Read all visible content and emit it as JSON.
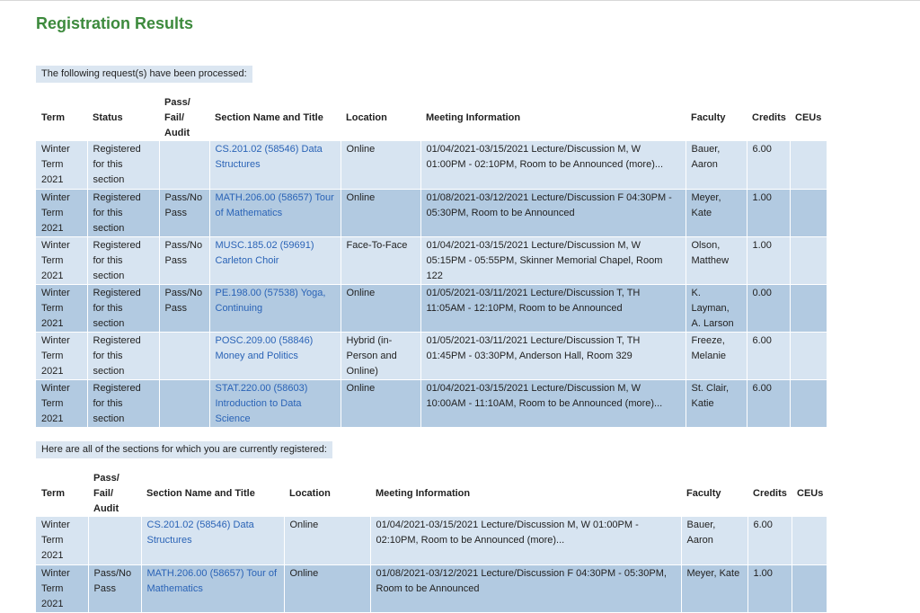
{
  "page_title": "Registration Results",
  "processed_banner": "The following request(s) have been processed:",
  "registered_banner": "Here are all of the sections for which you are currently registered:",
  "processed_headers": {
    "term": "Term",
    "status": "Status",
    "pass_fail": [
      "Pass/",
      "Fail/",
      "Audit"
    ],
    "section": "Section Name and Title",
    "location": "Location",
    "meeting": "Meeting Information",
    "faculty": "Faculty",
    "credits": "Credits",
    "ceus": "CEUs"
  },
  "processed_rows": [
    {
      "term": "Winter Term 2021",
      "status": "Registered for this section",
      "pass_fail": "",
      "section": "CS.201.02 (58546) Data Structures",
      "location": "Online",
      "meeting": "01/04/2021-03/15/2021 Lecture/Discussion M, W 01:00PM - 02:10PM, Room to be Announced (more)...",
      "faculty": "Bauer, Aaron",
      "credits": "6.00",
      "ceus": ""
    },
    {
      "term": "Winter Term 2021",
      "status": "Registered for this section",
      "pass_fail": "Pass/No Pass",
      "section": "MATH.206.00 (58657) Tour of Mathematics",
      "location": "Online",
      "meeting": "01/08/2021-03/12/2021 Lecture/Discussion F 04:30PM - 05:30PM, Room to be Announced",
      "faculty": "Meyer, Kate",
      "credits": "1.00",
      "ceus": ""
    },
    {
      "term": "Winter Term 2021",
      "status": "Registered for this section",
      "pass_fail": "Pass/No Pass",
      "section": "MUSC.185.02 (59691) Carleton Choir",
      "location": "Face-To-Face",
      "meeting": "01/04/2021-03/15/2021 Lecture/Discussion M, W 05:15PM - 05:55PM, Skinner Memorial Chapel, Room 122",
      "faculty": "Olson, Matthew",
      "credits": "1.00",
      "ceus": ""
    },
    {
      "term": "Winter Term 2021",
      "status": "Registered for this section",
      "pass_fail": "Pass/No Pass",
      "section": "PE.198.00 (57538) Yoga, Continuing",
      "location": "Online",
      "meeting": "01/05/2021-03/11/2021 Lecture/Discussion T, TH 11:05AM - 12:10PM, Room to be Announced",
      "faculty": "K. Layman, A. Larson",
      "credits": "0.00",
      "ceus": ""
    },
    {
      "term": "Winter Term 2021",
      "status": "Registered for this section",
      "pass_fail": "",
      "section": "POSC.209.00 (58846) Money and Politics",
      "location": "Hybrid (in-Person and Online)",
      "meeting": "01/05/2021-03/11/2021 Lecture/Discussion T, TH 01:45PM - 03:30PM, Anderson Hall, Room 329",
      "faculty": "Freeze, Melanie",
      "credits": "6.00",
      "ceus": ""
    },
    {
      "term": "Winter Term 2021",
      "status": "Registered for this section",
      "pass_fail": "",
      "section": "STAT.220.00 (58603) Introduction to Data Science",
      "location": "Online",
      "meeting": "01/04/2021-03/15/2021 Lecture/Discussion M, W 10:00AM - 11:10AM, Room to be Announced (more)...",
      "faculty": "St. Clair, Katie",
      "credits": "6.00",
      "ceus": ""
    }
  ],
  "registered_headers": {
    "term": "Term",
    "pass_fail": [
      "Pass/",
      "Fail/",
      "Audit"
    ],
    "section": "Section Name and Title",
    "location": "Location",
    "meeting": "Meeting Information",
    "faculty": "Faculty",
    "credits": "Credits",
    "ceus": "CEUs"
  },
  "registered_rows": [
    {
      "term": "Winter Term 2021",
      "pass_fail": "",
      "section": "CS.201.02 (58546) Data Structures",
      "location": "Online",
      "meeting": "01/04/2021-03/15/2021 Lecture/Discussion M, W 01:00PM - 02:10PM, Room to be Announced (more)...",
      "faculty": "Bauer, Aaron",
      "credits": "6.00",
      "ceus": ""
    },
    {
      "term": "Winter Term 2021",
      "pass_fail": "Pass/No Pass",
      "section": "MATH.206.00 (58657) Tour of Mathematics",
      "location": "Online",
      "meeting": "01/08/2021-03/12/2021 Lecture/Discussion F 04:30PM - 05:30PM, Room to be Announced",
      "faculty": "Meyer, Kate",
      "credits": "1.00",
      "ceus": ""
    }
  ],
  "colors": {
    "title": "#3d8a3d",
    "link": "#2a63b6",
    "row_light": "#d7e4f1",
    "row_dark": "#b2cae1",
    "banner": "#dbe6f1"
  }
}
